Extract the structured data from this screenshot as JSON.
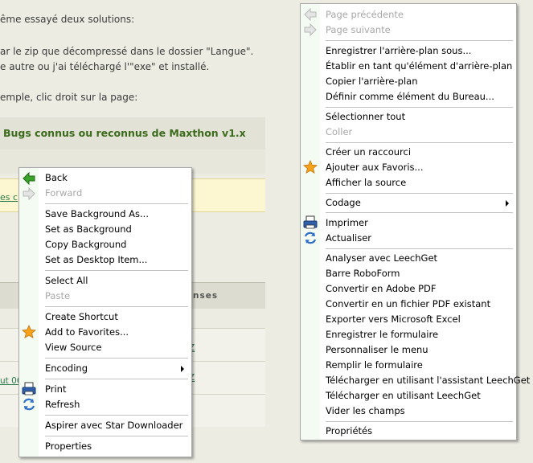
{
  "post": {
    "line1": "ême essayé deux solutions:",
    "line2": "ar le zip que décompressé dans le dossier \"Langue\".",
    "line3": "e autre ou j'ai téléchargé l'\"exe\" et installé.",
    "line4": "emple, clic droit sur la page:"
  },
  "screenshot": {
    "title": "Bugs connus ou reconnus de Maxthon v1.x",
    "link_yellow": "es c",
    "column_header": "nses",
    "row1_link": "Z",
    "row2_link": "ut 06",
    "row2_right": "Z"
  },
  "menu_en": {
    "back": "Back",
    "forward": "Forward",
    "save_background": "Save Background As...",
    "set_background": "Set as Background",
    "copy_background": "Copy Background",
    "set_desktop": "Set as Desktop Item...",
    "select_all": "Select All",
    "paste": "Paste",
    "create_shortcut": "Create Shortcut",
    "add_favorites": "Add to Favorites...",
    "view_source": "View Source",
    "encoding": "Encoding",
    "print": "Print",
    "refresh": "Refresh",
    "aspirer": "Aspirer avec Star Downloader",
    "properties": "Properties"
  },
  "menu_fr": {
    "page_precedente": "Page précédente",
    "page_suivante": "Page suivante",
    "enregistrer_arriere_plan": "Enregistrer l'arrière-plan sous...",
    "etablir_arriere_plan": "Établir en tant qu'élément d'arrière-plan",
    "copier_arriere_plan": "Copier l'arrière-plan",
    "definir_bureau": "Définir comme élément du Bureau...",
    "selectionner_tout": "Sélectionner tout",
    "coller": "Coller",
    "creer_raccourci": "Créer un raccourci",
    "ajouter_favoris": "Ajouter aux Favoris...",
    "afficher_source": "Afficher la source",
    "codage": "Codage",
    "imprimer": "Imprimer",
    "actualiser": "Actualiser",
    "analyser_leechget": "Analyser avec LeechGet",
    "barre_roboform": "Barre RoboForm",
    "convertir_pdf": "Convertir en Adobe PDF",
    "convertir_pdf_existant": "Convertir en un fichier PDF existant",
    "exporter_excel": "Exporter vers Microsoft Excel",
    "enregistrer_formulaire": "Enregistrer le formulaire",
    "personnaliser_menu": "Personnaliser le menu",
    "remplir_formulaire": "Remplir le formulaire",
    "telecharger_assistant": "Télécharger en utilisant l'assistant LeechGet",
    "telecharger_leechget": "Télécharger en utilisant LeechGet",
    "vider_champs": "Vider les champs",
    "proprietes": "Propriétés"
  },
  "colors": {
    "background": "#ecece3",
    "title_green": "#3c6b1d",
    "menu_gutter": "#f4fbf2",
    "disabled_text": "#a8a8a8"
  },
  "icons": [
    "back-arrow-icon",
    "forward-arrow-icon",
    "star-icon",
    "printer-icon",
    "refresh-icon",
    "submenu-arrow-icon"
  ]
}
